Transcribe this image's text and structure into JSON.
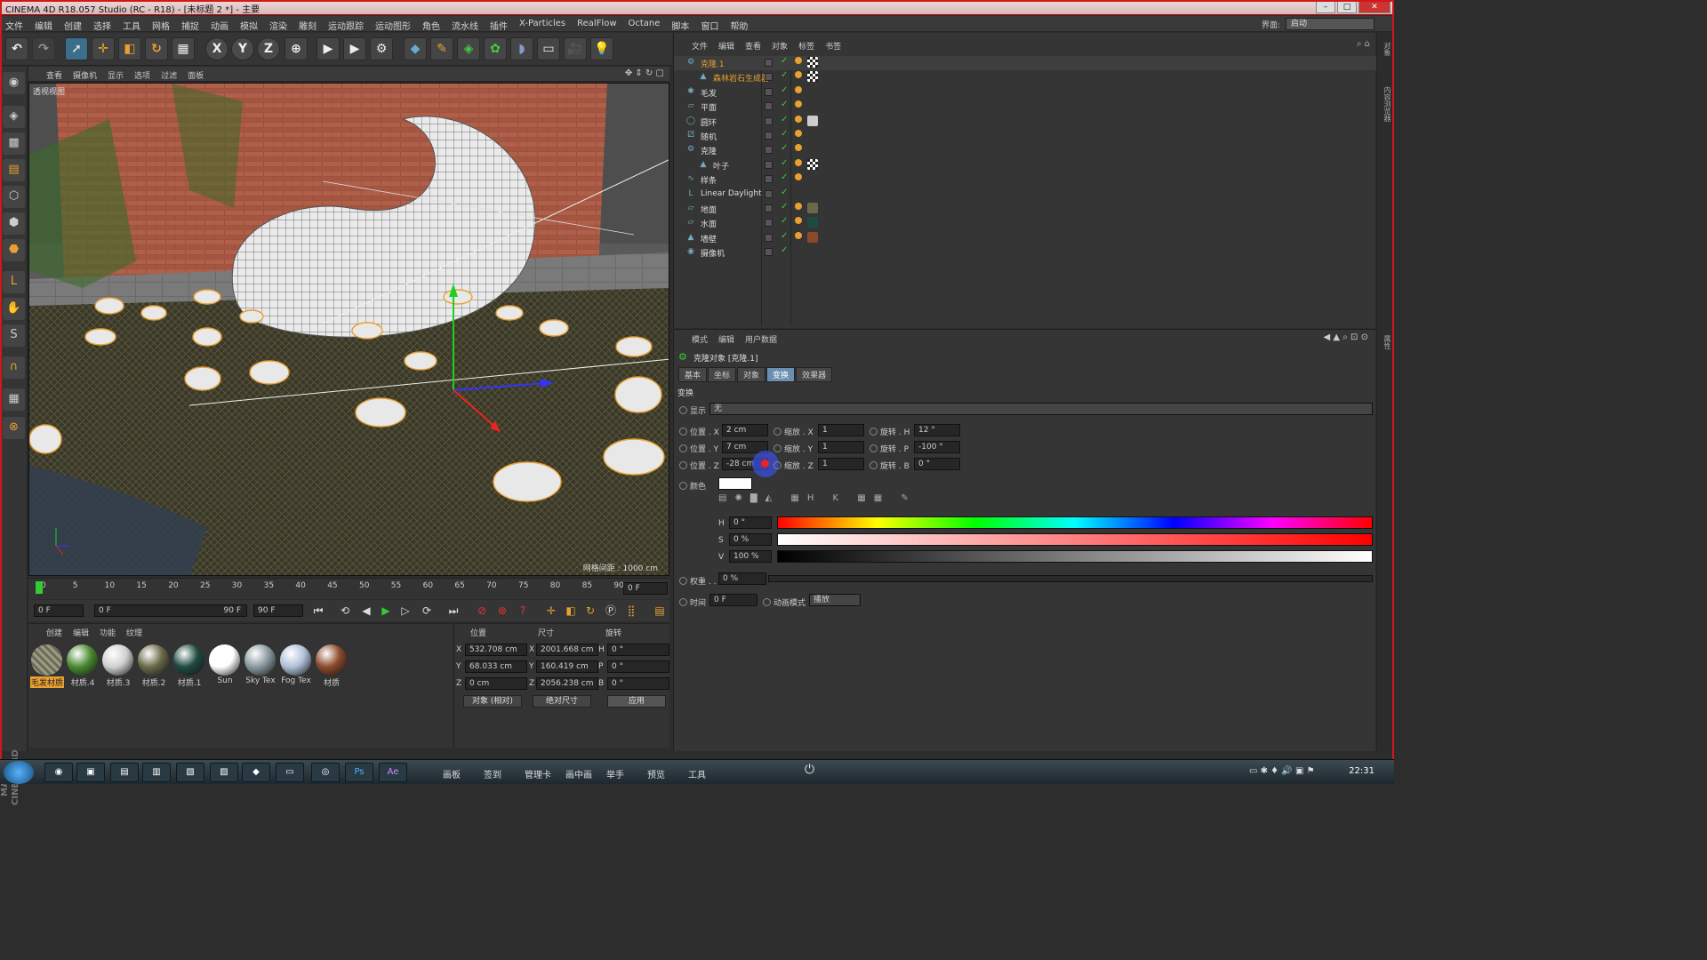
{
  "window": {
    "title": "CINEMA 4D R18.057 Studio (RC - R18) - [未标题 2 *] - 主要"
  },
  "menubar": {
    "items": [
      "文件",
      "编辑",
      "创建",
      "选择",
      "工具",
      "网格",
      "捕捉",
      "动画",
      "模拟",
      "渲染",
      "雕刻",
      "运动跟踪",
      "运动图形",
      "角色",
      "流水线",
      "插件",
      "X-Particles",
      "RealFlow",
      "Octane",
      "脚本",
      "窗口",
      "帮助"
    ],
    "layout_label": "界面:",
    "layout_value": "启动"
  },
  "viewport": {
    "menu": [
      "查看",
      "摄像机",
      "显示",
      "选项",
      "过滤",
      "面板"
    ],
    "label": "透视视图",
    "grid_text": "网格间距 : 1000 cm"
  },
  "timeline": {
    "ticks": [
      "0",
      "5",
      "10",
      "15",
      "20",
      "25",
      "30",
      "35",
      "40",
      "45",
      "50",
      "55",
      "60",
      "65",
      "70",
      "75",
      "80",
      "85",
      "90"
    ],
    "current_frame": "0 F",
    "start": "0 F",
    "range_start": "0 F",
    "range_end": "90 F",
    "end": "90 F"
  },
  "materials": {
    "menu": [
      "创建",
      "编辑",
      "功能",
      "纹理"
    ],
    "items": [
      {
        "label": "毛发材质",
        "color": "#8a8a70",
        "selected": true
      },
      {
        "label": "材质.4",
        "color": "#4a8a30"
      },
      {
        "label": "材质.3",
        "color": "#d0d0d0"
      },
      {
        "label": "材质.2",
        "color": "#6a6a4a"
      },
      {
        "label": "材质.1",
        "color": "#1e4a40"
      },
      {
        "label": "Sun",
        "color": "#ffffff"
      },
      {
        "label": "Sky Tex",
        "color": "#8a9aa0"
      },
      {
        "label": "Fog Tex",
        "color": "#b0c0d8"
      },
      {
        "label": "材质",
        "color": "#8a4a2a"
      }
    ]
  },
  "coords": {
    "headers": [
      "位置",
      "尺寸",
      "旋转"
    ],
    "rows": [
      {
        "axis": "X",
        "pos": "532.708 cm",
        "size_axis": "X",
        "size": "2001.668 cm",
        "rot_axis": "H",
        "rot": "0 °"
      },
      {
        "axis": "Y",
        "pos": "68.033 cm",
        "size_axis": "Y",
        "size": "160.419 cm",
        "rot_axis": "P",
        "rot": "0 °"
      },
      {
        "axis": "Z",
        "pos": "0 cm",
        "size_axis": "Z",
        "size": "2056.238 cm",
        "rot_axis": "B",
        "rot": "0 °"
      }
    ],
    "mode": "对象 (相对)",
    "size_mode": "绝对尺寸",
    "apply": "应用"
  },
  "object_manager": {
    "menu": [
      "文件",
      "编辑",
      "查看",
      "对象",
      "标签",
      "书签"
    ],
    "objects": [
      {
        "name": "克隆.1",
        "indent": 0,
        "orange": true,
        "icon": "⚙"
      },
      {
        "name": "森林岩石生成器",
        "indent": 1,
        "orange": true,
        "icon": "▲"
      },
      {
        "name": "毛发",
        "indent": 0,
        "icon": "✱"
      },
      {
        "name": "平面",
        "indent": 0,
        "icon": "▱"
      },
      {
        "name": "圆环",
        "indent": 0,
        "icon": "◯"
      },
      {
        "name": "随机",
        "indent": 0,
        "icon": "⚂"
      },
      {
        "name": "克隆",
        "indent": 0,
        "icon": "⚙"
      },
      {
        "name": "叶子",
        "indent": 1,
        "icon": "▲"
      },
      {
        "name": "样条",
        "indent": 0,
        "icon": "∿"
      },
      {
        "name": "Linear Daylight",
        "indent": 0,
        "icon": "L"
      },
      {
        "name": "地面",
        "indent": 0,
        "icon": "▱"
      },
      {
        "name": "水面",
        "indent": 0,
        "icon": "▱"
      },
      {
        "name": "墙壁",
        "indent": 0,
        "icon": "▲"
      },
      {
        "name": "摄像机",
        "indent": 0,
        "icon": "◉"
      }
    ]
  },
  "attributes": {
    "menu": [
      "模式",
      "编辑",
      "用户数据"
    ],
    "object_title": "克隆对象 [克隆.1]",
    "tabs": [
      "基本",
      "坐标",
      "对象",
      "变换",
      "效果器"
    ],
    "active_tab": "变换",
    "section": "变换",
    "display_label": "显示",
    "display_value": "无",
    "pos_x_label": "位置 . X",
    "pos_x": "2 cm",
    "pos_y_label": "位置 . Y",
    "pos_y": "7 cm",
    "pos_z_label": "位置 . Z",
    "pos_z": "-28 cm",
    "scale_x_label": "缩放 . X",
    "scale_x": "1",
    "scale_y_label": "缩放 . Y",
    "scale_y": "1",
    "scale_z_label": "缩放 . Z",
    "scale_z": "1",
    "rot_h_label": "旋转 . H",
    "rot_h": "12 °",
    "rot_p_label": "旋转 . P",
    "rot_p": "-100 °",
    "rot_b_label": "旋转 . B",
    "rot_b": "0 °",
    "color_label": "颜色",
    "h_label": "H",
    "h_value": "0 °",
    "s_label": "S",
    "s_value": "0 %",
    "v_label": "V",
    "v_value": "100 %",
    "weight_label": "权重 . .",
    "weight_value": "0 %",
    "time_label": "时间",
    "time_value": "0 F",
    "anim_mode_label": "动画模式",
    "anim_mode_value": "播放"
  },
  "taskbar": {
    "quicklaunch": [
      "画板",
      "签到",
      "管理卡",
      "画中画",
      "举手",
      "预览",
      "工具"
    ],
    "clock": "22:31"
  },
  "colors": {
    "accent_orange": "#e8a030",
    "selection_blue": "#6b8fb3",
    "title_red": "#d01818"
  }
}
